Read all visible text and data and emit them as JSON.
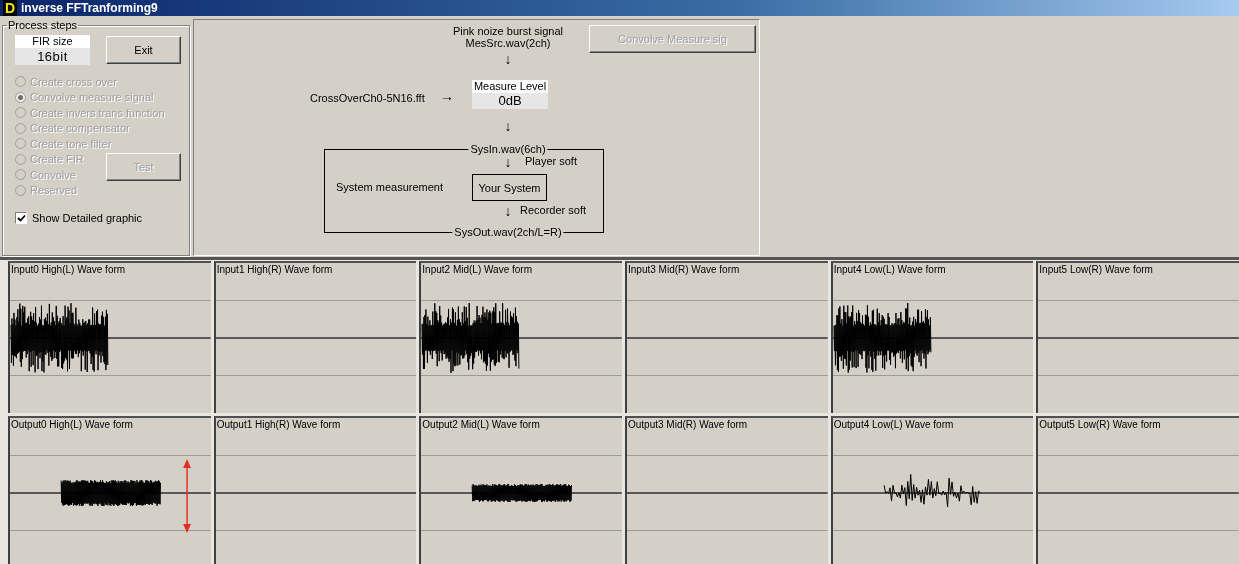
{
  "window": {
    "icon_letter": "D",
    "title": "inverse FFTranforming9"
  },
  "process_steps": {
    "legend": "Process steps",
    "fir_size": {
      "label": "FIR size",
      "value": "16bit"
    },
    "exit_button": {
      "label": "Exit",
      "disabled": false
    },
    "steps": [
      {
        "label": "Create cross over",
        "selected": false,
        "disabled": true
      },
      {
        "label": "Convolve measure signal",
        "selected": true,
        "disabled": true
      },
      {
        "label": "Create invers trans function",
        "selected": false,
        "disabled": true
      },
      {
        "label": "Create compensator",
        "selected": false,
        "disabled": true
      },
      {
        "label": "Create tone filter",
        "selected": false,
        "disabled": true
      },
      {
        "label": "Create FIR",
        "selected": false,
        "disabled": true
      },
      {
        "label": "Convolve",
        "selected": false,
        "disabled": true
      },
      {
        "label": "Reserved",
        "selected": false,
        "disabled": true
      }
    ],
    "test_button": {
      "label": "Test",
      "disabled": true
    },
    "show_detailed_graphic": {
      "label": "Show Detailed graphic",
      "checked": true
    }
  },
  "diagram": {
    "source_title": "Pink noize burst signal",
    "source_file": "MesSrc.wav(2ch)",
    "arrow_down": "↓",
    "arrow_right": "→",
    "crossover_file": "CrossOverCh0-5N16.fft",
    "measure_level": {
      "label": "Measure Level",
      "value": "0dB"
    },
    "sys_in": "SysIn.wav(6ch)",
    "player": "Player soft",
    "system_label": "System measurement",
    "system_box": "Your System",
    "recorder": "Recorder soft",
    "sys_out": "SysOut.wav(2ch/L=R)",
    "convolve_button": {
      "label": "Convolve Measure sig",
      "disabled": true
    }
  },
  "input_waves": [
    {
      "title": "Input0 High(L) Wave form",
      "kind": "burst",
      "marker": false
    },
    {
      "title": "Input1 High(R) Wave form",
      "kind": "none",
      "marker": false
    },
    {
      "title": "Input2 Mid(L) Wave form",
      "kind": "burst",
      "marker": false
    },
    {
      "title": "Input3 Mid(R) Wave form",
      "kind": "none",
      "marker": false
    },
    {
      "title": "Input4 Low(L) Wave form",
      "kind": "burst",
      "marker": false
    },
    {
      "title": "Input5 Low(R) Wave form",
      "kind": "none",
      "marker": false
    }
  ],
  "output_waves": [
    {
      "title": "Output0 High(L) Wave form",
      "kind": "steady",
      "marker": true
    },
    {
      "title": "Output1 High(R) Wave form",
      "kind": "none",
      "marker": false
    },
    {
      "title": "Output2 Mid(L) Wave form",
      "kind": "weak",
      "marker": false
    },
    {
      "title": "Output3 Mid(R) Wave form",
      "kind": "none",
      "marker": false
    },
    {
      "title": "Output4 Low(L) Wave form",
      "kind": "sparse",
      "marker": false
    },
    {
      "title": "Output5 Low(R) Wave form",
      "kind": "none",
      "marker": false
    }
  ]
}
